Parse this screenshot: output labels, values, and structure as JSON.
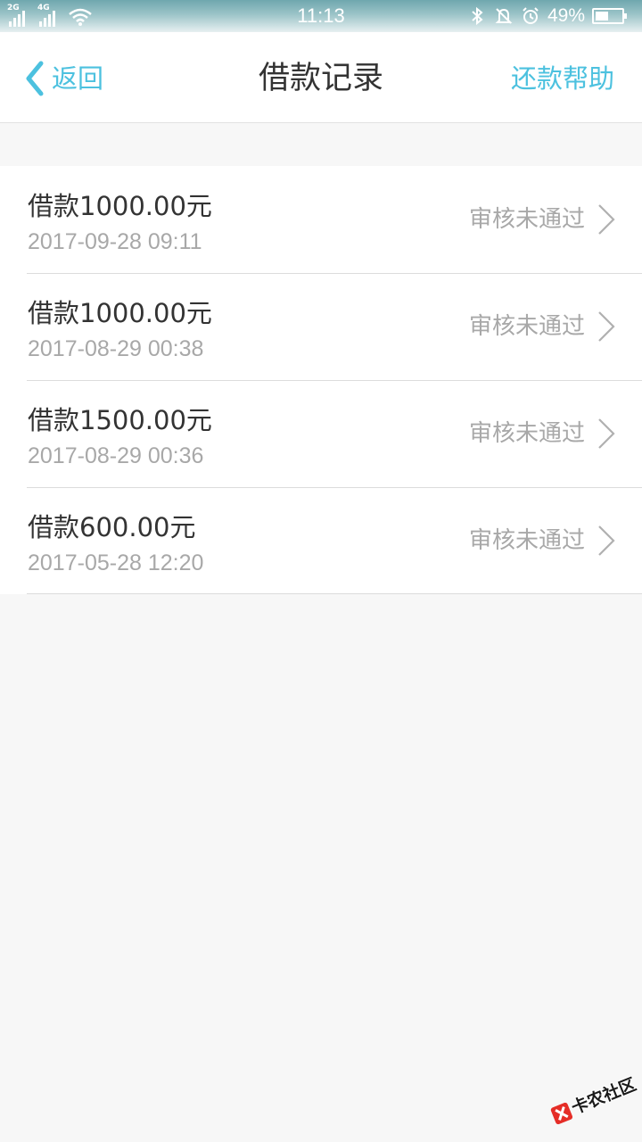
{
  "status_bar": {
    "network_1": "2G",
    "network_2": "4G",
    "time": "11:13",
    "battery_percent": "49%",
    "battery_level": 0.49,
    "icons": [
      "signal-icon",
      "signal-icon",
      "wifi-icon",
      "bluetooth-icon",
      "mute-icon",
      "alarm-icon",
      "battery-icon"
    ]
  },
  "nav": {
    "back_label": "返回",
    "title": "借款记录",
    "help_label": "还款帮助",
    "accent_color": "#4cc1df"
  },
  "records": [
    {
      "amount": "借款1000.00元",
      "time": "2017-09-28 09:11",
      "status": "审核未通过"
    },
    {
      "amount": "借款1000.00元",
      "time": "2017-08-29 00:38",
      "status": "审核未通过"
    },
    {
      "amount": "借款1500.00元",
      "time": "2017-08-29 00:36",
      "status": "审核未通过"
    },
    {
      "amount": "借款600.00元",
      "time": "2017-05-28 12:20",
      "status": "审核未通过"
    }
  ],
  "watermark": {
    "text": "卡农社区"
  }
}
